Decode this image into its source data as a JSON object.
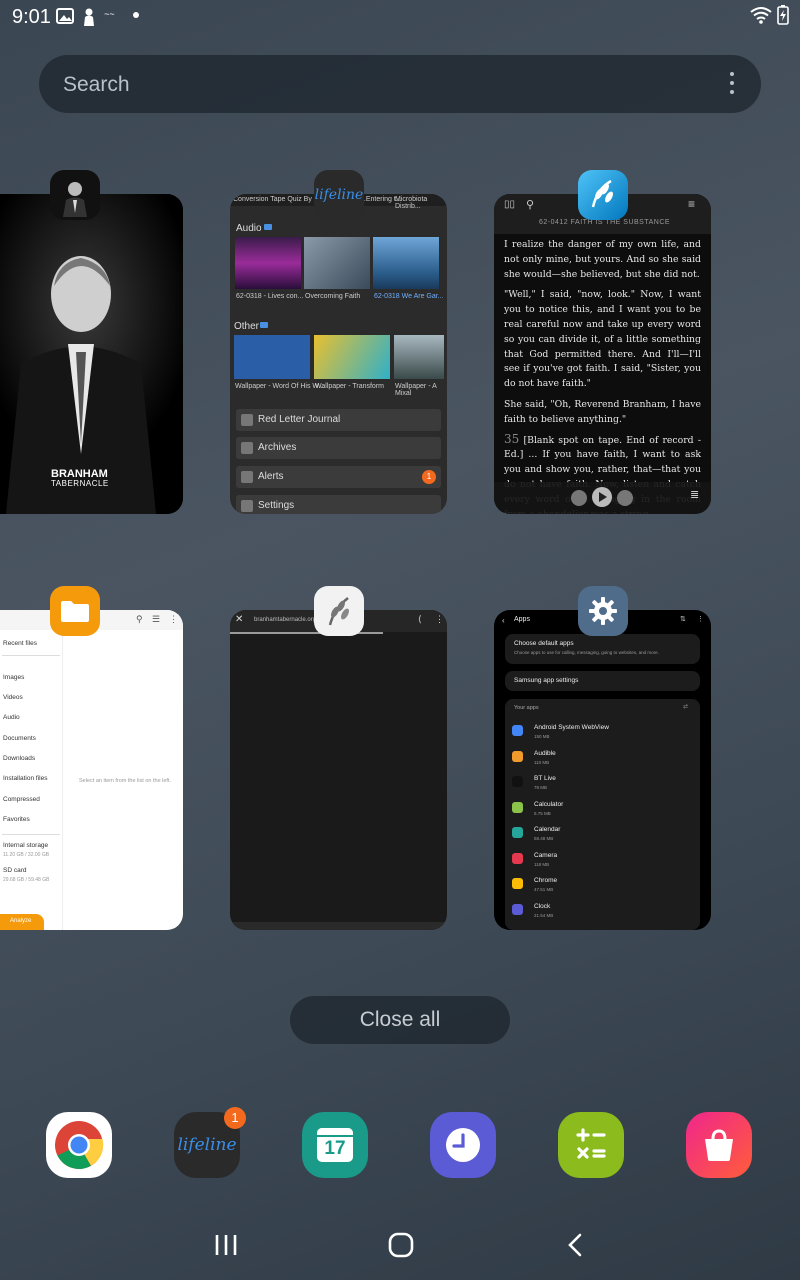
{
  "status_bar": {
    "time": "9:01"
  },
  "search": {
    "placeholder": "Search"
  },
  "recents": {
    "branham": {
      "brand_line1": "BRANHAM",
      "brand_line2": "TABERNACLE"
    },
    "lifeline": {
      "top_tabs": [
        "Conversion Tape Quiz By P...",
        "...Entering t...",
        "Microbiota Distrib..."
      ],
      "audio_label": "Audio",
      "audio_items": [
        "62-0318 - Lives con...",
        "Overcoming Faith",
        "62-0318 We Are Gar..."
      ],
      "other_label": "Other",
      "other_items": [
        "Wallpaper - Word Of His W...",
        "Wallpaper - Transform",
        "Wallpaper - A Mixal"
      ],
      "menu": [
        "Red Letter Journal",
        "Archives",
        "Alerts",
        "Settings"
      ],
      "alerts_count": "1"
    },
    "reader": {
      "header": "62-0412 FAITH IS THE SUBSTANCE",
      "paragraphs": [
        "I realize the danger of my own life, and not only mine, but yours. And so she said she would—she believed, but she did not.",
        "\"Well,\" I said, \"now, look.\" Now, I want you to notice this, and I want you to be real careful now and take up every word so you can divide it, of a little something that God permitted there. And I'll—I'll see if you've got faith. I said, \"Sister, you do not have faith.\"",
        "She said, \"Oh, Reverend Branham, I have faith to believe anything.\"",
        "[Blank spot on tape. End of record - Ed.] ... If you have faith, I want to ask you and show you, rather, that—that you do not have faith. Now, listen and catch every word of it. Hanging in the room from a chandelier was a string,"
      ],
      "paragraph_number": "35"
    },
    "files": {
      "items": [
        "Recent files",
        "Images",
        "Videos",
        "Audio",
        "Documents",
        "Downloads",
        "Installation files",
        "Compressed",
        "Favorites",
        "Internal storage",
        "SD card"
      ],
      "internal_storage_detail": "11.20 GB / 32.00 GB",
      "sd_card_detail": "29.68 GB / 59.48 GB",
      "empty_message": "Select an item from the list on the left.",
      "analyze_button": "Analyze"
    },
    "browser": {
      "url": "branhamtabernacle.org"
    },
    "settings": {
      "title": "Apps",
      "choose_default": "Choose default apps",
      "choose_default_sub": "Choose apps to use for calling, messaging, going to websites, and more.",
      "samsung_settings": "Samsung app settings",
      "your_apps": "Your apps",
      "apps": [
        {
          "name": "Android System WebView",
          "size": "150 MB",
          "color": "#4285f4"
        },
        {
          "name": "Audible",
          "size": "110 MB",
          "color": "#f29b2c"
        },
        {
          "name": "BT Live",
          "size": "78 MB",
          "color": "#111111"
        },
        {
          "name": "Calculator",
          "size": "5.75 MB",
          "color": "#8bc34a"
        },
        {
          "name": "Calendar",
          "size": "58.48 MB",
          "color": "#26a69a"
        },
        {
          "name": "Camera",
          "size": "118 MB",
          "color": "#e53950"
        },
        {
          "name": "Chrome",
          "size": "47.51 MB",
          "color": "#fbbc05"
        },
        {
          "name": "Clock",
          "size": "21.54 MB",
          "color": "#5b5bd6"
        }
      ]
    }
  },
  "close_all": "Close all",
  "dock": {
    "lifeline_badge": "1",
    "calendar_day": "17"
  },
  "colors": {
    "files_accent": "#f59b0b",
    "settings_accent": "#4f6c8a"
  }
}
